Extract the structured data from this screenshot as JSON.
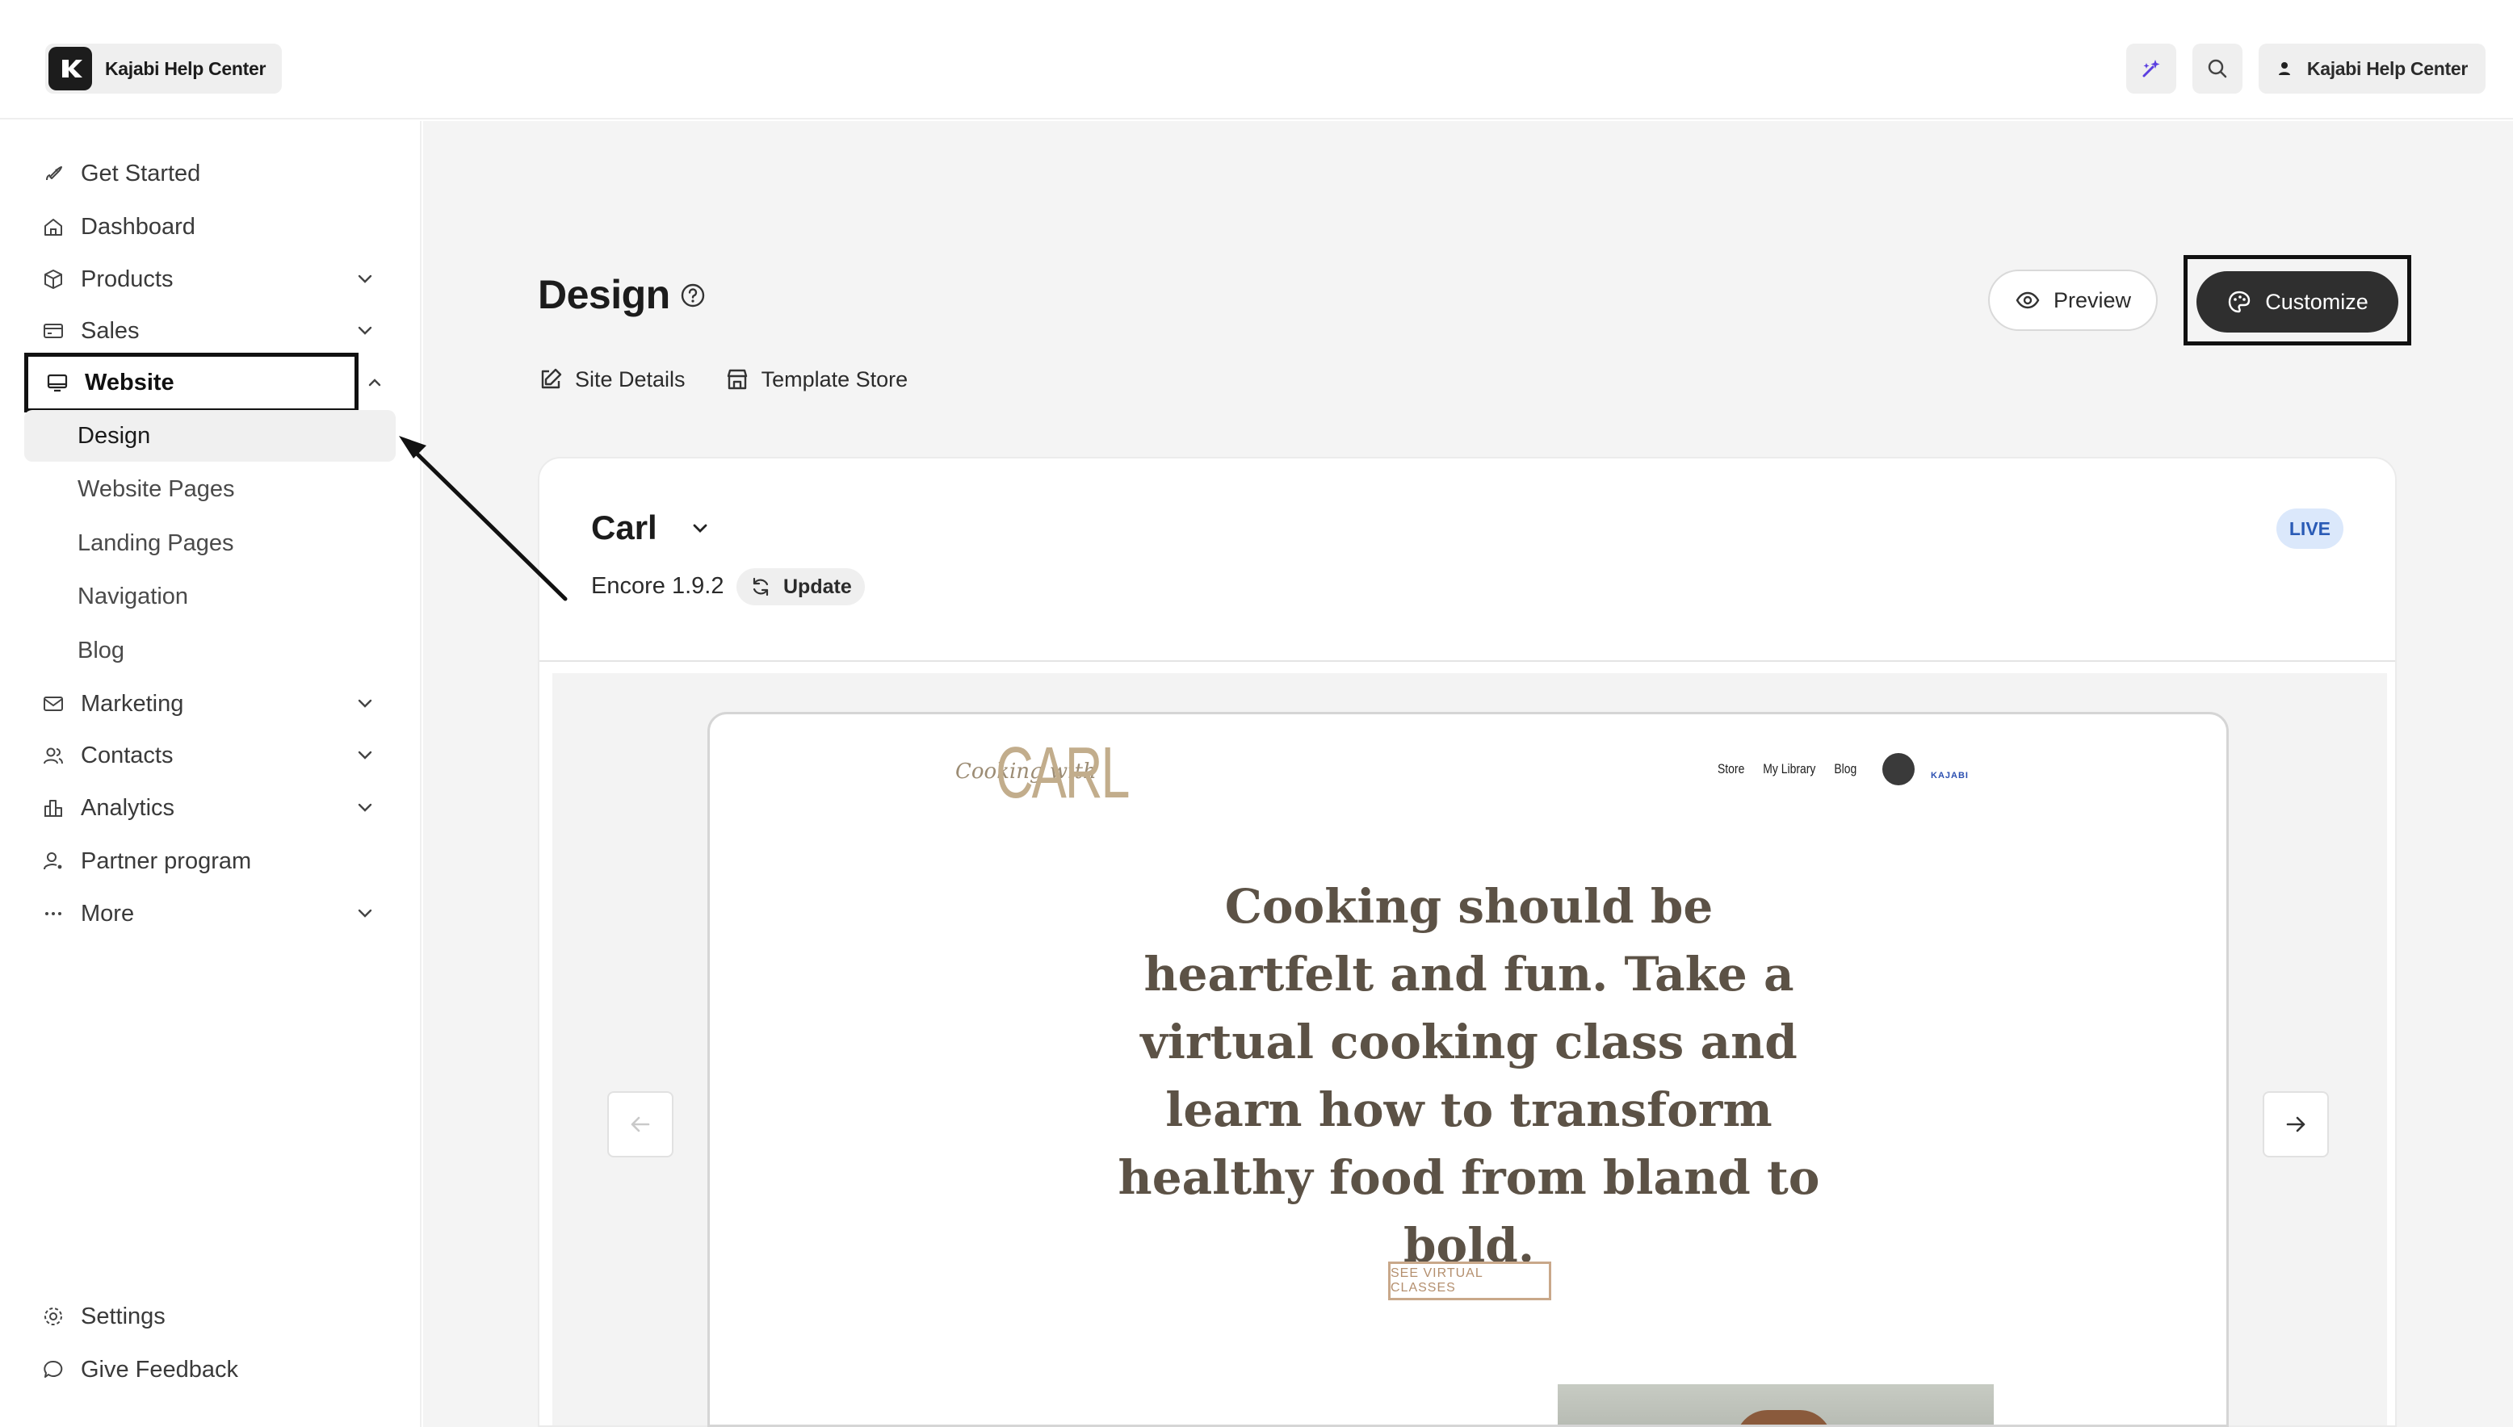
{
  "topbar": {
    "brand_name": "Kajabi Help Center",
    "account_label": "Kajabi Help Center",
    "ai_icon": "sparkle-icon",
    "search_icon": "search-icon"
  },
  "sidebar": {
    "items": [
      {
        "label": "Get Started",
        "icon": "rocket-icon"
      },
      {
        "label": "Dashboard",
        "icon": "home-icon"
      },
      {
        "label": "Products",
        "icon": "box-icon"
      },
      {
        "label": "Sales",
        "icon": "credit-card-icon"
      },
      {
        "label": "Website",
        "icon": "monitor-icon"
      },
      {
        "label": "Marketing",
        "icon": "mail-icon"
      },
      {
        "label": "Contacts",
        "icon": "users-icon"
      },
      {
        "label": "Analytics",
        "icon": "bar-chart-icon"
      },
      {
        "label": "Partner program",
        "icon": "user-plus-icon"
      },
      {
        "label": "More",
        "icon": "more-icon"
      }
    ],
    "website_sub": [
      "Design",
      "Website Pages",
      "Landing Pages",
      "Navigation",
      "Blog"
    ],
    "bottom": [
      {
        "label": "Settings",
        "icon": "gear-icon"
      },
      {
        "label": "Give Feedback",
        "icon": "chat-icon"
      }
    ]
  },
  "main": {
    "title": "Design",
    "tabs": [
      "Site Details",
      "Template Store"
    ],
    "preview_label": "Preview",
    "customize_label": "Customize",
    "theme": {
      "name": "Carl",
      "status": "LIVE",
      "version": "Encore 1.9.2",
      "update_label": "Update"
    },
    "site_preview": {
      "logo_script": "Cooking with",
      "logo": "CARL",
      "nav": [
        "Store",
        "My Library",
        "Blog"
      ],
      "kajabi": "KAJABI",
      "hero": "Cooking should be heartfelt and fun. Take a virtual cooking class and learn how to transform healthy food from bland to bold.",
      "cta": "SEE VIRTUAL CLASSES"
    }
  },
  "colors": {
    "accent_dark": "#2f2f2f",
    "live_badge_bg": "#dbe8fb",
    "live_badge_text": "#2a5bb6",
    "hero_text": "#5c5246"
  }
}
